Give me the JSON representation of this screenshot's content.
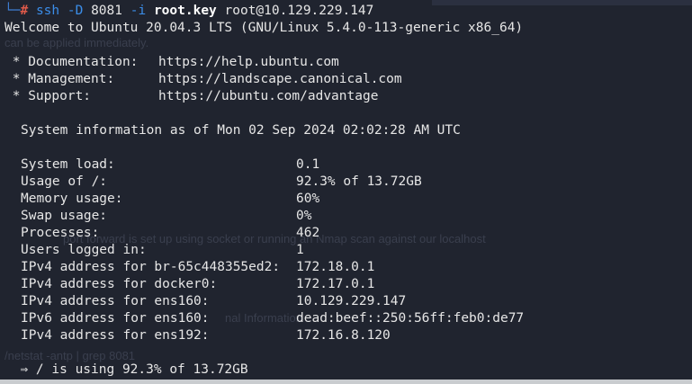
{
  "prompt": {
    "corner": "└─",
    "hash": "#",
    "command": "ssh",
    "flag_d": "-D",
    "port": "8081",
    "flag_i": "-i",
    "keyfile": "root.key",
    "target": "root@10.129.229.147"
  },
  "welcome": "Welcome to Ubuntu 20.04.3 LTS (GNU/Linux 5.4.0-113-generic x86_64)",
  "links": [
    {
      "label": " * Documentation:",
      "url": "https://help.ubuntu.com"
    },
    {
      "label": " * Management:",
      "url": "https://landscape.canonical.com"
    },
    {
      "label": " * Support:",
      "url": "https://ubuntu.com/advantage"
    }
  ],
  "sysinfo_header": "System information as of Mon 02 Sep 2024 02:02:28 AM UTC",
  "stats": [
    {
      "label": "System load:",
      "value": "0.1"
    },
    {
      "label": "Usage of /:",
      "value": "92.3% of 13.72GB"
    },
    {
      "label": "Memory usage:",
      "value": "60%"
    },
    {
      "label": "Swap usage:",
      "value": "0%"
    },
    {
      "label": "Processes:",
      "value": "462"
    },
    {
      "label": "Users logged in:",
      "value": "1"
    },
    {
      "label": "IPv4 address for br-65c448355ed2:",
      "value": "172.18.0.1"
    },
    {
      "label": "IPv4 address for docker0:",
      "value": "172.17.0.1"
    },
    {
      "label": "IPv4 address for ens160:",
      "value": "10.129.229.147"
    },
    {
      "label": "IPv6 address for ens160:",
      "value": "dead:beef::250:56ff:feb0:de77"
    },
    {
      "label": "IPv4 address for ens192:",
      "value": "172.16.8.120"
    }
  ],
  "warning": "  ⇒ / is using 92.3% of 13.72GB",
  "ghost_text": {
    "g1": "can be applied immediately.",
    "g2": "port forward is set up using socket or running an Nmap scan against our localhost",
    "g3": "/netstat -antp | grep 8081",
    "g4": "nal Information"
  },
  "colors": {
    "background": "#20242f",
    "text": "#e6e6e6",
    "command": "#3b8eea",
    "prompt_hash": "#e05a4a"
  }
}
